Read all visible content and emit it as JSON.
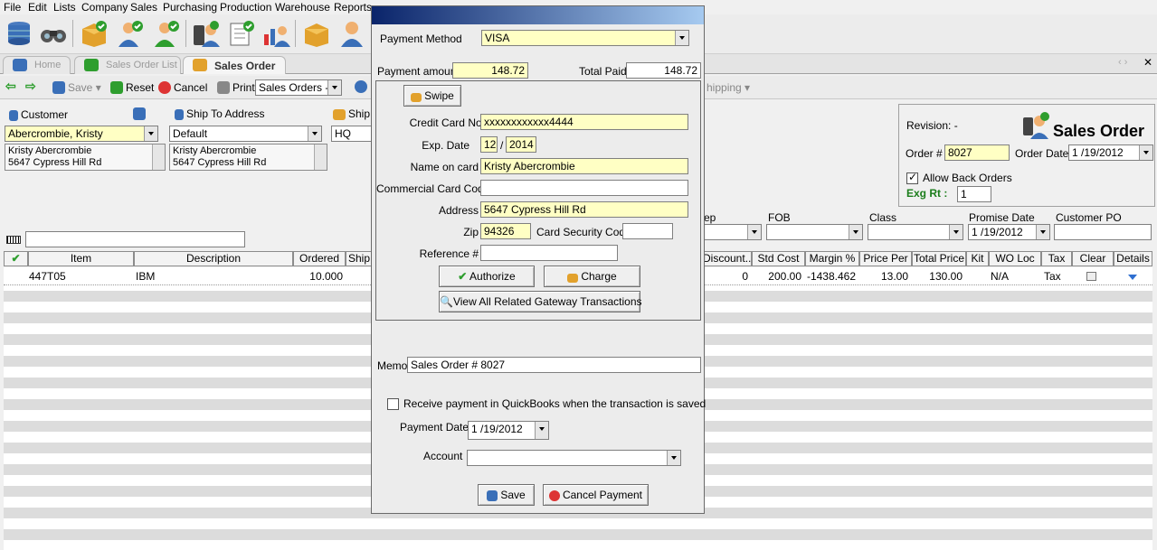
{
  "menu": [
    "File",
    "Edit",
    "Lists",
    "Company",
    "Sales",
    "Purchasing",
    "Production",
    "Warehouse",
    "Reports"
  ],
  "toolbar_icons": [
    "database-icon",
    "binoculars-icon",
    "package-check-icon",
    "user-check-icon",
    "user-green-icon",
    "phone-user-icon",
    "document-check-icon",
    "chart-user-icon",
    "package-icon",
    "user-icon"
  ],
  "tabs": {
    "home": "Home",
    "sales_order_list": "Sales Order List",
    "sales_order": "Sales Order"
  },
  "actions": {
    "save": "Save",
    "reset": "Reset",
    "cancel": "Cancel",
    "print": "Print",
    "print_select": "Sales Orders - C",
    "shipping": "hipping"
  },
  "customer": {
    "label": "Customer",
    "value": "Abercrombie, Kristy",
    "address_line1": "Kristy Abercrombie",
    "address_line2": "5647 Cypress Hill Rd"
  },
  "ship_to": {
    "label": "Ship To Address",
    "value": "Default",
    "address_line1": "Kristy Abercrombie",
    "address_line2": "5647 Cypress Hill Rd"
  },
  "ship_from": {
    "label": "Ship",
    "value": "HQ"
  },
  "order_panel": {
    "revision": "Revision: -",
    "title": "Sales Order",
    "order_label": "Order #",
    "order_number": "8027",
    "order_date_label": "Order Date",
    "order_date": "1 /19/2012",
    "allow_back_orders": "Allow Back Orders",
    "exg_label": "Exg Rt :",
    "exg_value": "1"
  },
  "middle_fields": {
    "rep_label": "ep",
    "fob_label": "FOB",
    "class_label": "Class",
    "promise_label": "Promise Date",
    "promise_value": "1 /19/2012",
    "po_label": "Customer PO"
  },
  "grid": {
    "headers_left": [
      "Item",
      "Description",
      "Ordered",
      "Ship"
    ],
    "headers_right": [
      "Discount...",
      "Std Cost",
      "Margin %",
      "Price Per",
      "Total Price",
      "Kit",
      "WO Loc",
      "Tax",
      "Clear",
      "Details"
    ],
    "row": {
      "item": "447T05",
      "description": "IBM",
      "ordered": "10.000",
      "discount": "0",
      "std_cost": "200.00",
      "margin": "-1438.462",
      "price_per": "13.00",
      "total_price": "130.00",
      "wo_loc": "N/A",
      "tax": "Tax"
    }
  },
  "dialog": {
    "payment_method_label": "Payment Method",
    "payment_method": "VISA",
    "payment_amount_label": "Payment amount",
    "payment_amount": "148.72",
    "total_paid_label": "Total Paid",
    "total_paid": "148.72",
    "swipe": "Swipe",
    "cc_label": "Credit Card No.",
    "cc_value": "xxxxxxxxxxxx4444",
    "exp_label": "Exp. Date",
    "exp_month": "12",
    "exp_sep": "/",
    "exp_year": "2014",
    "name_label": "Name on card",
    "name_value": "Kristy Abercrombie",
    "commercial_label": "Commercial Card Code",
    "commercial_value": "",
    "address_label": "Address",
    "address_value": "5647 Cypress Hill Rd",
    "zip_label": "Zip",
    "zip_value": "94326",
    "csc_label": "Card Security Code",
    "csc_value": "",
    "ref_label": "Reference #",
    "ref_value": "",
    "authorize": "Authorize",
    "charge": "Charge",
    "view_all": "View All Related Gateway Transactions",
    "memo_label": "Memo",
    "memo_value": "Sales Order # 8027",
    "receive_qb": "Receive payment in QuickBooks when the transaction is saved",
    "payment_date_label": "Payment Date",
    "payment_date": "1 /19/2012",
    "account_label": "Account",
    "account_value": "",
    "save": "Save",
    "cancel_payment": "Cancel Payment"
  },
  "colors": {
    "yellow_field": "#ffffc4",
    "title_start": "#0a246a",
    "title_end": "#a6caf0",
    "stripe": "#dcdcdc"
  }
}
